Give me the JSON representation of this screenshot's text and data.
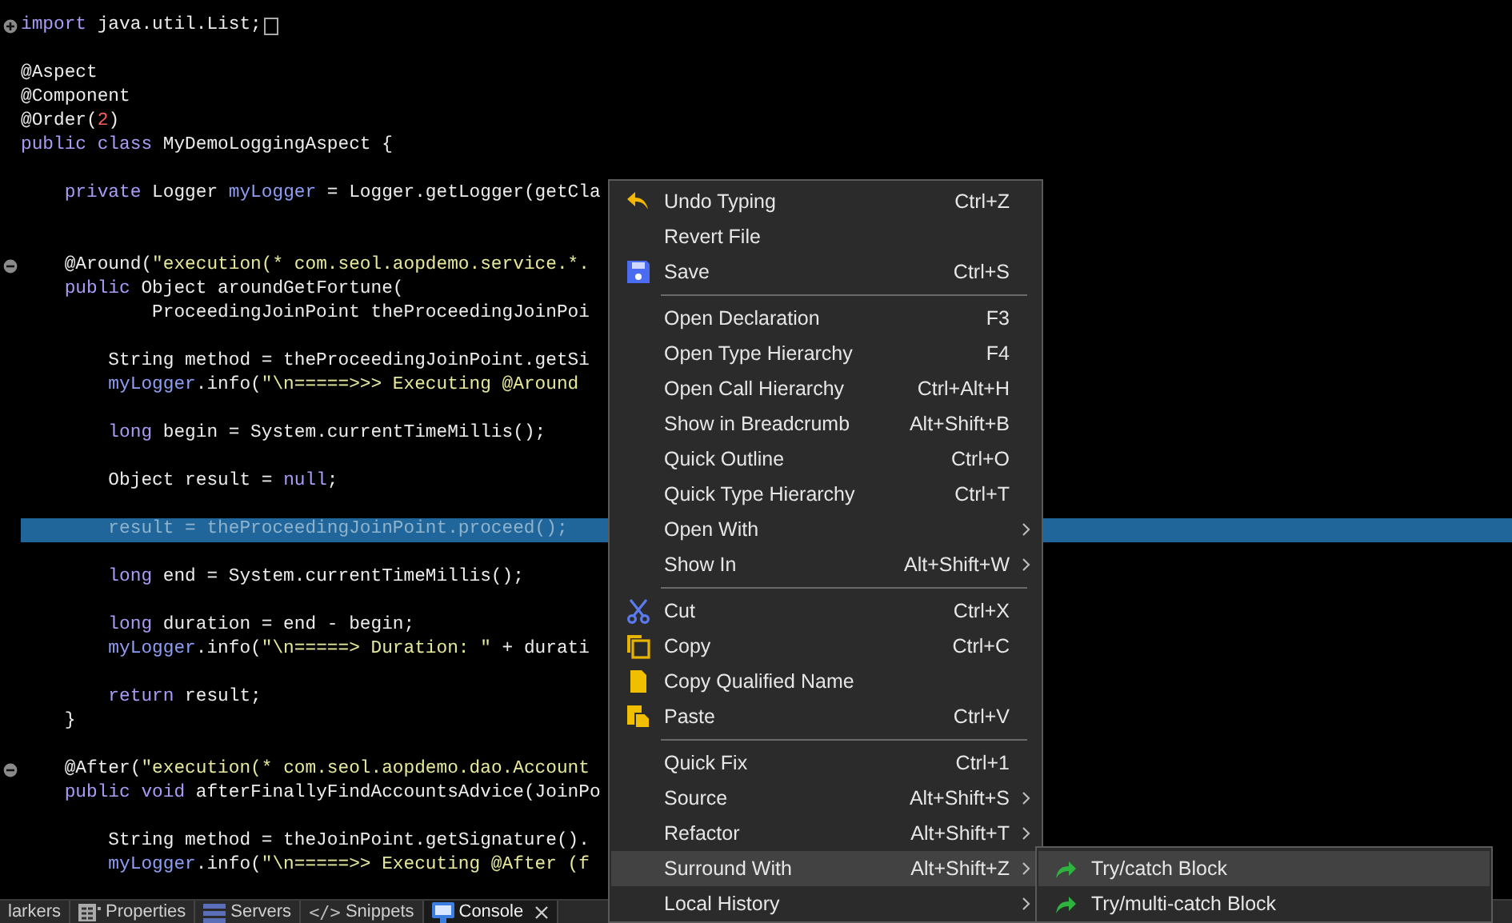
{
  "editor": {
    "lines": [
      {
        "kind": "code",
        "selected": false,
        "collapsed": true,
        "tokens": [
          {
            "kind": "keyword",
            "text": "import"
          },
          {
            "kind": "plain",
            "text": " java.util.List;"
          }
        ]
      },
      {
        "kind": "blank"
      },
      {
        "kind": "code",
        "selected": false,
        "tokens": [
          {
            "kind": "plain",
            "text": "@Aspect"
          }
        ]
      },
      {
        "kind": "code",
        "selected": false,
        "tokens": [
          {
            "kind": "plain",
            "text": "@Component"
          }
        ]
      },
      {
        "kind": "code",
        "selected": false,
        "tokens": [
          {
            "kind": "plain",
            "text": "@Order("
          },
          {
            "kind": "number",
            "text": "2"
          },
          {
            "kind": "plain",
            "text": ")"
          }
        ]
      },
      {
        "kind": "code",
        "selected": false,
        "tokens": [
          {
            "kind": "keyword",
            "text": "public class"
          },
          {
            "kind": "plain",
            "text": " MyDemoLoggingAspect {"
          }
        ]
      },
      {
        "kind": "blank"
      },
      {
        "kind": "code",
        "selected": false,
        "tokens": [
          {
            "kind": "keyword",
            "text": "    private"
          },
          {
            "kind": "plain",
            "text": " Logger "
          },
          {
            "kind": "field",
            "text": "myLogger"
          },
          {
            "kind": "plain",
            "text": " = Logger.getLogger(getCla"
          }
        ]
      },
      {
        "kind": "blank"
      },
      {
        "kind": "blank"
      },
      {
        "kind": "code",
        "selected": false,
        "collapsed": false,
        "tokens": [
          {
            "kind": "plain",
            "text": "    @Around("
          },
          {
            "kind": "string",
            "text": "\"execution(* com.seol.aopdemo.service.*."
          }
        ]
      },
      {
        "kind": "code",
        "selected": false,
        "tokens": [
          {
            "kind": "keyword",
            "text": "    public"
          },
          {
            "kind": "plain",
            "text": " Object aroundGetFortune("
          }
        ]
      },
      {
        "kind": "code",
        "selected": false,
        "tokens": [
          {
            "kind": "plain",
            "text": "            ProceedingJoinPoint theProceedingJoinPoi"
          }
        ]
      },
      {
        "kind": "blank"
      },
      {
        "kind": "code",
        "selected": false,
        "tokens": [
          {
            "kind": "plain",
            "text": "        String method = theProceedingJoinPoint.getSi"
          }
        ]
      },
      {
        "kind": "code",
        "selected": false,
        "tokens": [
          {
            "kind": "field",
            "text": "        myLogger"
          },
          {
            "kind": "plain",
            "text": ".info("
          },
          {
            "kind": "string",
            "text": "\"\\n=====>>> Executing @Around"
          }
        ]
      },
      {
        "kind": "blank"
      },
      {
        "kind": "code",
        "selected": false,
        "tokens": [
          {
            "kind": "keyword",
            "text": "        long"
          },
          {
            "kind": "plain",
            "text": " begin = System.currentTimeMillis();"
          }
        ]
      },
      {
        "kind": "blank"
      },
      {
        "kind": "code",
        "selected": false,
        "tokens": [
          {
            "kind": "plain",
            "text": "        Object result = "
          },
          {
            "kind": "keyword",
            "text": "null"
          },
          {
            "kind": "plain",
            "text": ";"
          }
        ]
      },
      {
        "kind": "blank"
      },
      {
        "kind": "code",
        "selected": true,
        "tokens": [
          {
            "kind": "plain",
            "text": "        result = theProceedingJoinPoint.proceed();"
          }
        ]
      },
      {
        "kind": "blank"
      },
      {
        "kind": "code",
        "selected": false,
        "tokens": [
          {
            "kind": "keyword",
            "text": "        long"
          },
          {
            "kind": "plain",
            "text": " end = System.currentTimeMillis();"
          }
        ]
      },
      {
        "kind": "blank"
      },
      {
        "kind": "code",
        "selected": false,
        "tokens": [
          {
            "kind": "keyword",
            "text": "        long"
          },
          {
            "kind": "plain",
            "text": " duration = end - begin;"
          }
        ]
      },
      {
        "kind": "code",
        "selected": false,
        "tokens": [
          {
            "kind": "field",
            "text": "        myLogger"
          },
          {
            "kind": "plain",
            "text": ".info("
          },
          {
            "kind": "string",
            "text": "\"\\n=====> Duration: \""
          },
          {
            "kind": "plain",
            "text": " + durati"
          }
        ]
      },
      {
        "kind": "blank"
      },
      {
        "kind": "code",
        "selected": false,
        "tokens": [
          {
            "kind": "keyword",
            "text": "        return"
          },
          {
            "kind": "plain",
            "text": " result;"
          }
        ]
      },
      {
        "kind": "code",
        "selected": false,
        "tokens": [
          {
            "kind": "plain",
            "text": "    }"
          }
        ]
      },
      {
        "kind": "blank"
      },
      {
        "kind": "code",
        "selected": false,
        "collapsed": false,
        "tokens": [
          {
            "kind": "plain",
            "text": "    @After("
          },
          {
            "kind": "string",
            "text": "\"execution(* com.seol.aopdemo.dao.Account"
          }
        ]
      },
      {
        "kind": "code",
        "selected": false,
        "tokens": [
          {
            "kind": "keyword",
            "text": "    public void"
          },
          {
            "kind": "plain",
            "text": " afterFinallyFindAccountsAdvice(JoinPo"
          }
        ]
      },
      {
        "kind": "blank"
      },
      {
        "kind": "code",
        "selected": false,
        "tokens": [
          {
            "kind": "plain",
            "text": "        String method = theJoinPoint.getSignature()."
          }
        ]
      },
      {
        "kind": "code",
        "selected": false,
        "tokens": [
          {
            "kind": "field",
            "text": "        myLogger"
          },
          {
            "kind": "plain",
            "text": ".info("
          },
          {
            "kind": "string",
            "text": "\"\\n=====>> Executing @After (f"
          }
        ]
      }
    ]
  },
  "bottom_tabs": [
    {
      "label": "larkers",
      "selected": false
    },
    {
      "label": "Properties",
      "selected": false
    },
    {
      "label": "Servers",
      "selected": false
    },
    {
      "label": "Snippets",
      "glyph": "</>",
      "selected": false
    },
    {
      "label": "Console",
      "selected": true
    }
  ],
  "menu": {
    "items": [
      {
        "kind": "item",
        "label": "Undo Typing",
        "shortcut": "Ctrl+Z",
        "submenu": false,
        "selected": false
      },
      {
        "kind": "item",
        "label": "Revert File",
        "submenu": false,
        "selected": false
      },
      {
        "kind": "item",
        "label": "Save",
        "shortcut": "Ctrl+S",
        "submenu": false,
        "selected": false
      },
      {
        "kind": "separator"
      },
      {
        "kind": "item",
        "label": "Open Declaration",
        "shortcut": "F3",
        "submenu": false,
        "selected": false
      },
      {
        "kind": "item",
        "label": "Open Type Hierarchy",
        "shortcut": "F4",
        "submenu": false,
        "selected": false
      },
      {
        "kind": "item",
        "label": "Open Call Hierarchy",
        "shortcut": "Ctrl+Alt+H",
        "submenu": false,
        "selected": false
      },
      {
        "kind": "item",
        "label": "Show in Breadcrumb",
        "shortcut": "Alt+Shift+B",
        "submenu": false,
        "selected": false
      },
      {
        "kind": "item",
        "label": "Quick Outline",
        "shortcut": "Ctrl+O",
        "submenu": false,
        "selected": false
      },
      {
        "kind": "item",
        "label": "Quick Type Hierarchy",
        "shortcut": "Ctrl+T",
        "submenu": false,
        "selected": false
      },
      {
        "kind": "item",
        "label": "Open With",
        "submenu": true,
        "selected": false
      },
      {
        "kind": "item",
        "label": "Show In",
        "shortcut": "Alt+Shift+W",
        "submenu": true,
        "selected": false
      },
      {
        "kind": "separator"
      },
      {
        "kind": "item",
        "label": "Cut",
        "shortcut": "Ctrl+X",
        "submenu": false,
        "selected": false
      },
      {
        "kind": "item",
        "label": "Copy",
        "shortcut": "Ctrl+C",
        "submenu": false,
        "selected": false
      },
      {
        "kind": "item",
        "label": "Copy Qualified Name",
        "submenu": false,
        "selected": false
      },
      {
        "kind": "item",
        "label": "Paste",
        "shortcut": "Ctrl+V",
        "submenu": false,
        "selected": false
      },
      {
        "kind": "separator"
      },
      {
        "kind": "item",
        "label": "Quick Fix",
        "shortcut": "Ctrl+1",
        "submenu": false,
        "selected": false
      },
      {
        "kind": "item",
        "label": "Source",
        "shortcut": "Alt+Shift+S",
        "submenu": true,
        "selected": false
      },
      {
        "kind": "item",
        "label": "Refactor",
        "shortcut": "Alt+Shift+T",
        "submenu": true,
        "selected": false
      },
      {
        "kind": "item",
        "label": "Surround With",
        "shortcut": "Alt+Shift+Z",
        "submenu": true,
        "selected": true
      },
      {
        "kind": "item",
        "label": "Local History",
        "submenu": true,
        "selected": false
      }
    ]
  },
  "submenu": {
    "items": [
      {
        "label": "Try/catch Block",
        "selected": true
      },
      {
        "label": "Try/multi-catch Block",
        "selected": false
      }
    ]
  }
}
